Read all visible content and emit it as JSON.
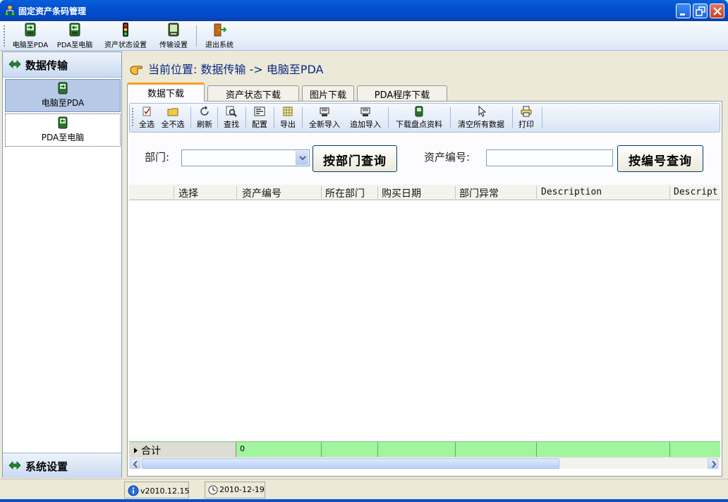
{
  "window": {
    "title": "固定资产条码管理"
  },
  "toolbar": {
    "items": [
      {
        "label": "电脑至PDA",
        "icon": "pc-to-pda-icon"
      },
      {
        "label": "PDA至电脑",
        "icon": "pda-to-pc-icon"
      },
      {
        "label": "资产状态设置",
        "icon": "traffic-light-icon"
      },
      {
        "label": "传输设置",
        "icon": "pda-device-icon"
      },
      {
        "label": "退出系统",
        "icon": "exit-door-icon"
      }
    ]
  },
  "sidebar": {
    "group1": "数据传输",
    "items": [
      {
        "label": "电脑至PDA",
        "selected": true
      },
      {
        "label": "PDA至电脑",
        "selected": false
      }
    ],
    "group2": "系统设置"
  },
  "main": {
    "location": "当前位置: 数据传输 -> 电脑至PDA",
    "tabs": [
      "数据下载",
      "资产状态下载",
      "图片下载",
      "PDA程序下载"
    ],
    "active_tab": 0,
    "actions": [
      "全选",
      "全不选",
      "刷新",
      "查找",
      "配置",
      "导出",
      "全新导入",
      "追加导入",
      "下载盘点资料",
      "清空所有数据",
      "打印"
    ],
    "search": {
      "dept_label": "部门:",
      "dept_value": "",
      "dept_button": "按部门查询",
      "asset_label": "资产编号:",
      "asset_value": "",
      "asset_button": "按编号查询"
    },
    "grid": {
      "columns": [
        "选择",
        "资产编号",
        "所在部门",
        "购买日期",
        "部门异常",
        "Description",
        "Descript"
      ],
      "totals_label": "合计",
      "totals_value": "0"
    }
  },
  "status": {
    "version": "v2010.12.15",
    "date": "2010-12-19"
  },
  "colors": {
    "titlebar": "#0450d0",
    "totals_row": "#a1f59d",
    "location_text": "#0b2a86"
  }
}
